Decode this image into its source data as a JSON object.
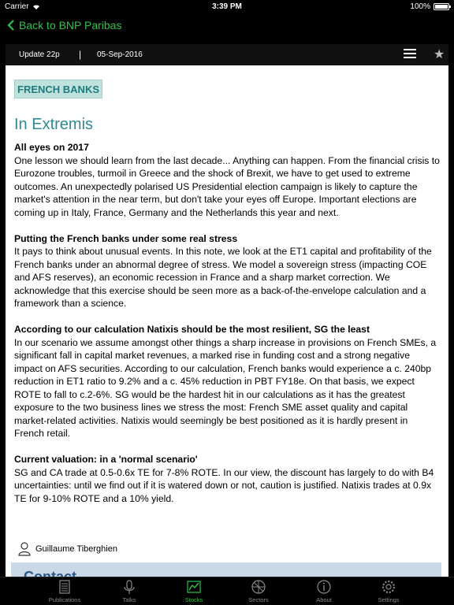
{
  "status_bar": {
    "carrier": "Carrier",
    "time": "3:39 PM",
    "battery": "100%"
  },
  "nav": {
    "back_label": "Back to BNP Paribas"
  },
  "card_header": {
    "update": "Update 22p",
    "separator": "|",
    "date": "05-Sep-2016"
  },
  "article": {
    "tag": "FRENCH BANKS",
    "title": "In Extremis",
    "sections": [
      {
        "heading": "All eyes on 2017",
        "body": "One lesson we should learn from the last decade... Anything can happen. From the financial crisis to Eurozone troubles, turmoil in Greece and the shock of Brexit, we have to get used to extreme outcomes. An unexpectedly polarised US Presidential election campaign is likely to capture the market's attention in the near term, but don't take your eyes off Europe. Important elections are coming up in Italy, France, Germany and the Netherlands this year and next."
      },
      {
        "heading": "Putting the French banks under some real stress",
        "body": "It pays to think about unusual events. In this note, we look at the ET1 capital and profitability of the French banks under an abnormal degree of stress. We model a sovereign stress (impacting COE and AFS reserves), an economic recession in France and a sharp market correction. We acknowledge that this exercise should be seen more as a back-of-the-envelope calculation and a framework than a science."
      },
      {
        "heading": "According to our calculation Natixis should be the most resilient, SG the least",
        "body": "In our scenario we assume amongst other things a sharp increase in provisions on French SMEs, a significant fall in capital market revenues, a marked rise in funding cost and a strong negative impact on AFS securities. According to our calculation, French banks would experience a c. 240bp reduction in ET1 ratio to 9.2% and a c. 45% reduction in PBT FY18e. On that basis, we expect ROTE to fall to c.2-6%. SG would be the hardest hit in our calculations as it has the greatest exposure to the two business lines we stress the most: French SME asset quality and capital market-related activities. Natixis would seemingly be best positioned as it is hardly present in French retail."
      },
      {
        "heading": "Current valuation: in a 'normal scenario'",
        "body": "SG and CA trade at 0.5-0.6x TE for 7-8% ROTE. In our view, the discount has largely to do with B4 uncertainties: until we find out if it is watered down or not, caution is justified. Natixis trades at 0.9x TE for 9-10% ROTE and a 10% yield."
      }
    ],
    "author": "Guillaume  Tiberghien",
    "contact_heading": "Contact"
  },
  "tabs": [
    {
      "label": "Publications",
      "icon": "publications-icon",
      "active": false
    },
    {
      "label": "Talks",
      "icon": "microphone-icon",
      "active": false
    },
    {
      "label": "Stocks",
      "icon": "chart-icon",
      "active": true
    },
    {
      "label": "Sectors",
      "icon": "sectors-icon",
      "active": false
    },
    {
      "label": "About",
      "icon": "info-icon",
      "active": false
    },
    {
      "label": "Settings",
      "icon": "gear-icon",
      "active": false
    }
  ],
  "colors": {
    "accent": "#2cc24a",
    "title": "#2e8a95",
    "tag_bg": "#bfe3dc"
  }
}
